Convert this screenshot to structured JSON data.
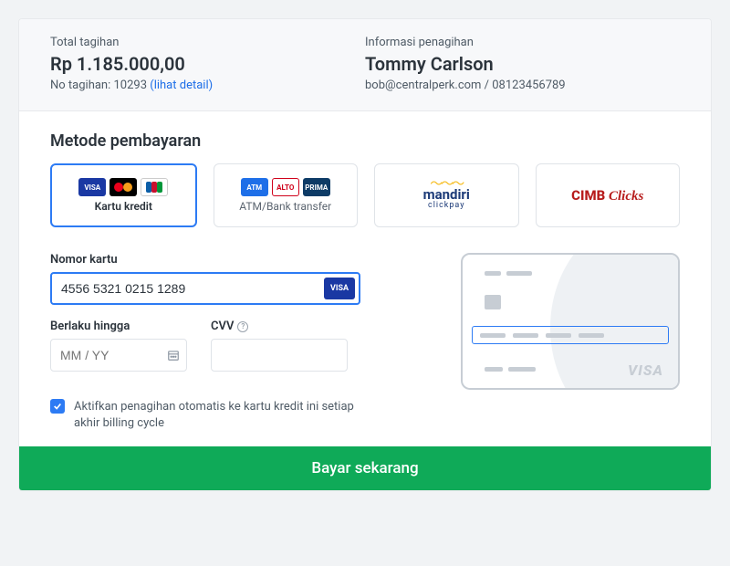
{
  "header": {
    "total_label": "Total tagihan",
    "total_value": "Rp 1.185.000,00",
    "invoice_prefix": "No tagihan: ",
    "invoice_no": "10293",
    "detail_link": "(lihat detail)",
    "billing_label": "Informasi penagihan",
    "billing_name": "Tommy Carlson",
    "billing_contact": "bob@centralperk.com / 08123456789"
  },
  "methods_title": "Metode pembayaran",
  "methods": {
    "credit": "Kartu kredit",
    "atm": "ATM/Bank transfer",
    "mandiri_name": "mandiri",
    "mandiri_sub": "clickpay",
    "cimb_a": "CIMB",
    "cimb_b": "Clicks"
  },
  "form": {
    "card_number_label": "Nomor kartu",
    "card_number_value": "4556 5321 0215 1289",
    "exp_label": "Berlaku hingga",
    "exp_placeholder": "MM / YY",
    "cvv_label": "CVV",
    "auto_billing_text": "Aktifkan penagihan otomatis ke kartu kredit ini setiap akhir billing cycle"
  },
  "card_brand": "VISA",
  "pay_button": "Bayar sekarang"
}
